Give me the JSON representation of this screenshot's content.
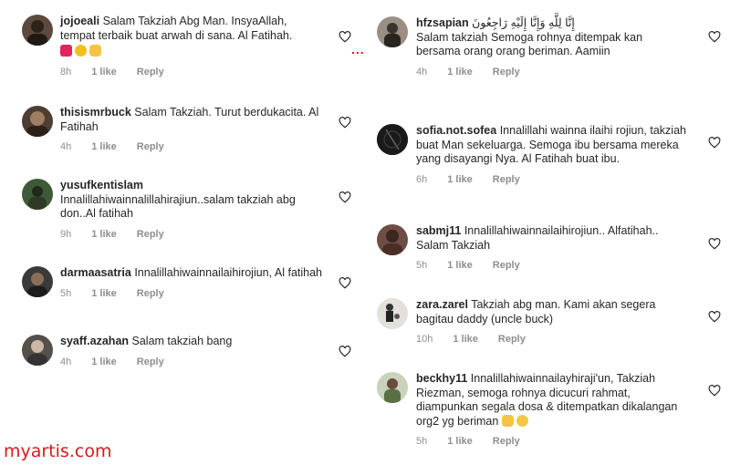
{
  "left_comments": [
    {
      "username": "jojoeali",
      "text": "Salam Takziah Abg Man. InsyaAllah, tempat terbaik buat arwah di sana. Al Fatihah.",
      "emoji": [
        "red-heart",
        "sunflower",
        "raised-hands"
      ],
      "time": "8h",
      "likes": "1 like",
      "reply": "Reply",
      "avatar_color": "#5b4a3d"
    },
    {
      "username": "thisismrbuck",
      "text": "Salam Takziah. Turut berdukacita. Al Fatihah",
      "time": "4h",
      "likes": "1 like",
      "reply": "Reply",
      "avatar_color": "#4d3d33"
    },
    {
      "username": "yusufkentislam",
      "text": "Innalillahiwainnalillahirajiun..salam takziah abg don..Al fatihah",
      "time": "9h",
      "likes": "1 like",
      "reply": "Reply",
      "avatar_color": "#3f5a36"
    },
    {
      "username": "darmaasatria",
      "text": "Innalillahiwainnailaihirojiun, Al fatihah",
      "time": "5h",
      "likes": "1 like",
      "reply": "Reply",
      "avatar_color": "#3a3a3a"
    },
    {
      "username": "syaff.azahan",
      "text": "Salam takziah bang",
      "time": "4h",
      "likes": "1 like",
      "reply": "Reply",
      "avatar_color": "#56504b"
    }
  ],
  "right_comments": [
    {
      "username": "hfzsapian",
      "text_rtl": "إِنَّا لِلَّهِ وَإِنَّا إِلَيْهِ رَاجِعُونَ",
      "text": "Salam takziah Semoga rohnya ditempak kan bersama orang orang beriman. Aamiin",
      "time": "4h",
      "likes": "1 like",
      "reply": "Reply",
      "avatar_color": "#9a8f85"
    },
    {
      "username": "sofia.not.sofea",
      "text": "Innalillahi wainna ilaihi rojiun, takziah buat Man sekeluarga. Semoga ibu bersama mereka yang disayangi Nya. Al Fatihah buat ibu.",
      "time": "6h",
      "likes": "1 like",
      "reply": "Reply",
      "avatar_color": "#222222"
    },
    {
      "username": "sabmj11",
      "text": "Innalillahiwainnailaihirojiun.. Alfatihah.. Salam Takziah",
      "time": "5h",
      "likes": "1 like",
      "reply": "Reply",
      "avatar_color": "#6e4e45"
    },
    {
      "username": "zara.zarel",
      "text": "Takziah abg man. Kami akan segera bagitau daddy (uncle buck)",
      "time": "10h",
      "likes": "1 like",
      "reply": "Reply",
      "avatar_color": "#bfbab4"
    },
    {
      "username": "beckhy11",
      "text": "Innalillahiwainnailayhiraji'un, Takziah Riezman, semoga rohnya dicucuri rahmat, diampunkan segala dosa & ditempatkan dikalangan org2 yg beriman",
      "emoji": [
        "raised-hands",
        "crying-face"
      ],
      "time": "5h",
      "likes": "1 like",
      "reply": "Reply",
      "avatar_color": "#7d8a6a"
    }
  ],
  "separator": "...",
  "watermark": "myartis.com",
  "colors": {
    "meta": "#8e8e8e",
    "text": "#262626",
    "watermark": "#d61a1a"
  }
}
